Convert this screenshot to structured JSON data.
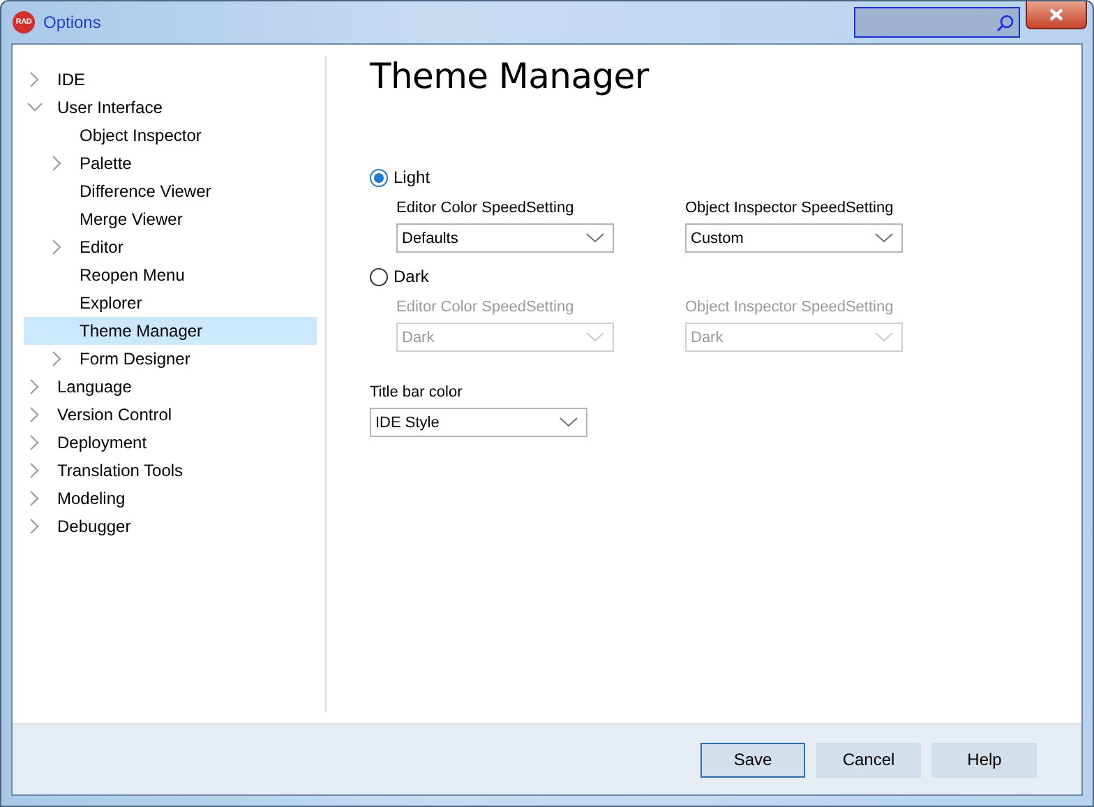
{
  "window": {
    "title": "Options",
    "app_icon_text": "RAD"
  },
  "tree": [
    {
      "label": "IDE",
      "kind": "branch",
      "expanded": false,
      "selected": false
    },
    {
      "label": "User Interface",
      "kind": "branch",
      "expanded": true,
      "selected": false,
      "children": [
        {
          "label": "Object Inspector",
          "kind": "leaf",
          "selected": false
        },
        {
          "label": "Palette",
          "kind": "branch",
          "expanded": false,
          "selected": false
        },
        {
          "label": "Difference Viewer",
          "kind": "leaf",
          "selected": false
        },
        {
          "label": "Merge Viewer",
          "kind": "leaf",
          "selected": false
        },
        {
          "label": "Editor",
          "kind": "branch",
          "expanded": false,
          "selected": false
        },
        {
          "label": "Reopen Menu",
          "kind": "leaf",
          "selected": false
        },
        {
          "label": "Explorer",
          "kind": "leaf",
          "selected": false
        },
        {
          "label": "Theme Manager",
          "kind": "leaf",
          "selected": true
        },
        {
          "label": "Form Designer",
          "kind": "branch",
          "expanded": false,
          "selected": false
        }
      ]
    },
    {
      "label": "Language",
      "kind": "branch",
      "expanded": false,
      "selected": false
    },
    {
      "label": "Version Control",
      "kind": "branch",
      "expanded": false,
      "selected": false
    },
    {
      "label": "Deployment",
      "kind": "branch",
      "expanded": false,
      "selected": false
    },
    {
      "label": "Translation Tools",
      "kind": "branch",
      "expanded": false,
      "selected": false
    },
    {
      "label": "Modeling",
      "kind": "branch",
      "expanded": false,
      "selected": false
    },
    {
      "label": "Debugger",
      "kind": "branch",
      "expanded": false,
      "selected": false
    }
  ],
  "page": {
    "heading": "Theme Manager",
    "themes": [
      {
        "label": "Light",
        "selected": true,
        "disabled": false,
        "combos": [
          {
            "label": "Editor Color SpeedSetting",
            "value": "Defaults"
          },
          {
            "label": "Object Inspector SpeedSetting",
            "value": "Custom"
          }
        ]
      },
      {
        "label": "Dark",
        "selected": false,
        "disabled": true,
        "combos": [
          {
            "label": "Editor Color SpeedSetting",
            "value": "Dark"
          },
          {
            "label": "Object Inspector SpeedSetting",
            "value": "Dark"
          }
        ]
      }
    ],
    "title_bar_color": {
      "label": "Title bar color",
      "value": "IDE Style"
    }
  },
  "buttons": [
    {
      "label": "Save",
      "focused": true
    },
    {
      "label": "Cancel",
      "focused": false
    },
    {
      "label": "Help",
      "focused": false
    }
  ]
}
